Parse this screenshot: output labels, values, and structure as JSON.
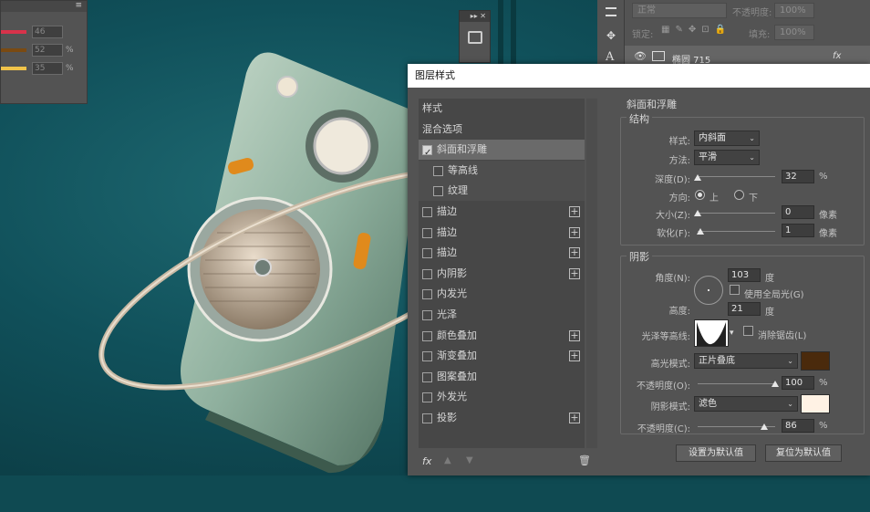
{
  "colors": {
    "canvas": "#0f4a52",
    "highlight_swatch": "#4a2a0c",
    "shadow_swatch": "#fff2e4"
  },
  "color_panel": {
    "rows": [
      {
        "value": "46",
        "unit": "",
        "bar_color": "#d8324a"
      },
      {
        "value": "52",
        "unit": "%",
        "bar_color": "#7a4a12"
      },
      {
        "value": "35",
        "unit": "%",
        "bar_color": "#f0c34a"
      }
    ]
  },
  "layers_panel": {
    "blend_mode": "正常",
    "opacity_label": "不透明度:",
    "opacity_value": "100%",
    "lock_label": "锁定:",
    "fill_label": "填充:",
    "fill_value": "100%",
    "layer_name": "椭圆 715",
    "fx": "fx"
  },
  "dialog": {
    "title": "图层样式",
    "sidebar": [
      {
        "label": "样式",
        "checkbox": false,
        "checked": false,
        "plus": false,
        "selected": false,
        "sub": false
      },
      {
        "label": "混合选项",
        "checkbox": false,
        "checked": false,
        "plus": false,
        "selected": false,
        "sub": false
      },
      {
        "label": "斜面和浮雕",
        "checkbox": true,
        "checked": true,
        "plus": false,
        "selected": true,
        "sub": false
      },
      {
        "label": "等高线",
        "checkbox": true,
        "checked": false,
        "plus": false,
        "selected": false,
        "sub": true
      },
      {
        "label": "纹理",
        "checkbox": true,
        "checked": false,
        "plus": false,
        "selected": false,
        "sub": true
      },
      {
        "label": "描边",
        "checkbox": true,
        "checked": false,
        "plus": true,
        "selected": false,
        "sub": false
      },
      {
        "label": "描边",
        "checkbox": true,
        "checked": false,
        "plus": true,
        "selected": false,
        "sub": false
      },
      {
        "label": "描边",
        "checkbox": true,
        "checked": false,
        "plus": true,
        "selected": false,
        "sub": false
      },
      {
        "label": "内阴影",
        "checkbox": true,
        "checked": false,
        "plus": true,
        "selected": false,
        "sub": false
      },
      {
        "label": "内发光",
        "checkbox": true,
        "checked": false,
        "plus": false,
        "selected": false,
        "sub": false
      },
      {
        "label": "光泽",
        "checkbox": true,
        "checked": false,
        "plus": false,
        "selected": false,
        "sub": false
      },
      {
        "label": "颜色叠加",
        "checkbox": true,
        "checked": false,
        "plus": true,
        "selected": false,
        "sub": false
      },
      {
        "label": "渐变叠加",
        "checkbox": true,
        "checked": false,
        "plus": true,
        "selected": false,
        "sub": false
      },
      {
        "label": "图案叠加",
        "checkbox": true,
        "checked": false,
        "plus": false,
        "selected": false,
        "sub": false
      },
      {
        "label": "外发光",
        "checkbox": true,
        "checked": false,
        "plus": false,
        "selected": false,
        "sub": false
      },
      {
        "label": "投影",
        "checkbox": true,
        "checked": false,
        "plus": true,
        "selected": false,
        "sub": false
      }
    ],
    "fx_label": "fx",
    "bevel": {
      "title": "斜面和浮雕",
      "structure_title": "结构",
      "style_label": "样式:",
      "style_value": "内斜面",
      "method_label": "方法:",
      "method_value": "平滑",
      "depth_label": "深度(D):",
      "depth_value": "32",
      "depth_unit": "%",
      "depth_level": 0.0,
      "direction_label": "方向:",
      "direction_up": "上",
      "direction_down": "下",
      "size_label": "大小(Z):",
      "size_value": "0",
      "size_unit": "像素",
      "size_level": 0.0,
      "soften_label": "软化(F):",
      "soften_value": "1",
      "soften_unit": "像素",
      "soften_level": 0.03
    },
    "shading": {
      "title": "阴影",
      "angle_label": "角度(N):",
      "angle_value": "103",
      "angle_unit": "度",
      "global_light_label": "使用全局光(G)",
      "altitude_label": "高度:",
      "altitude_value": "21",
      "altitude_unit": "度",
      "gloss_contour_label": "光泽等高线:",
      "anti_aliased_label": "消除锯齿(L)",
      "highlight_mode_label": "高光模式:",
      "highlight_mode_value": "正片叠底",
      "highlight_opacity_label": "不透明度(O):",
      "highlight_opacity_value": "100",
      "highlight_opacity_unit": "%",
      "highlight_opacity_level": 1.0,
      "shadow_mode_label": "阴影模式:",
      "shadow_mode_value": "滤色",
      "shadow_opacity_label": "不透明度(C):",
      "shadow_opacity_value": "86",
      "shadow_opacity_unit": "%",
      "shadow_opacity_level": 0.86
    },
    "make_default": "设置为默认值",
    "reset_default": "复位为默认值"
  }
}
